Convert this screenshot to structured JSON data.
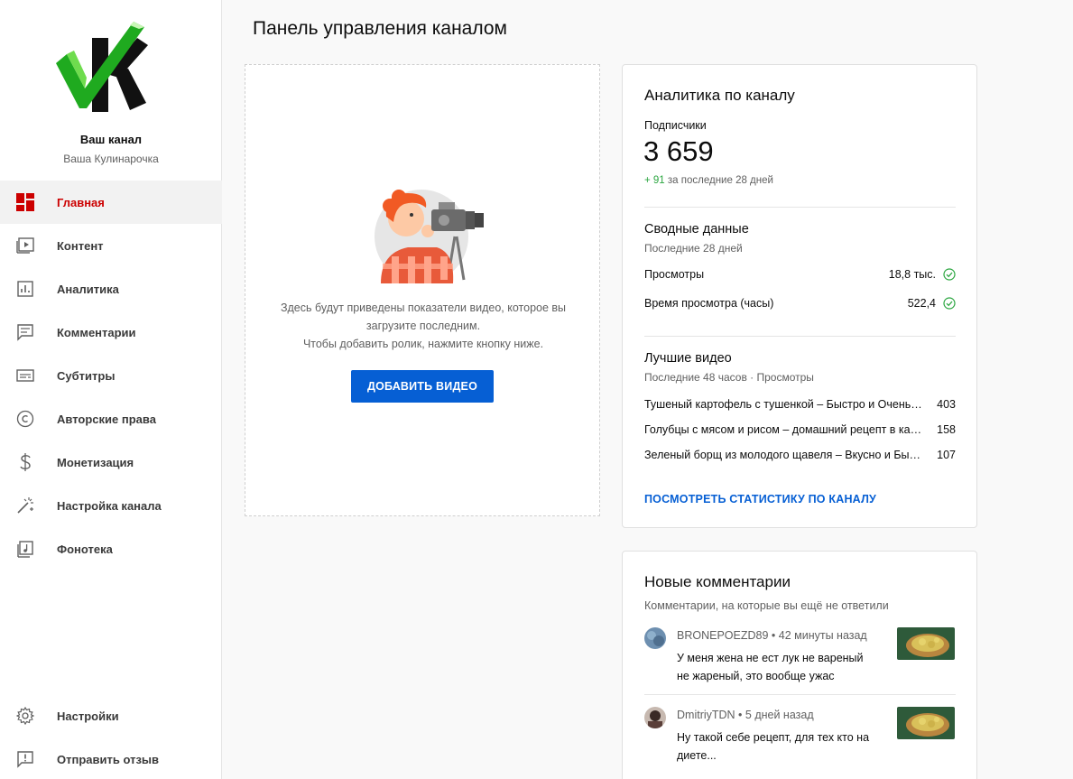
{
  "sidebar": {
    "channel_title": "Ваш канал",
    "channel_name": "Ваша Кулинарочка",
    "items": [
      {
        "label": "Главная",
        "icon": "dashboard-icon",
        "active": true
      },
      {
        "label": "Контент",
        "icon": "content-icon"
      },
      {
        "label": "Аналитика",
        "icon": "analytics-icon"
      },
      {
        "label": "Комментарии",
        "icon": "comments-icon"
      },
      {
        "label": "Субтитры",
        "icon": "subtitles-icon"
      },
      {
        "label": "Авторские права",
        "icon": "copyright-icon"
      },
      {
        "label": "Монетизация",
        "icon": "dollar-icon"
      },
      {
        "label": "Настройка канала",
        "icon": "magic-wand-icon"
      },
      {
        "label": "Фонотека",
        "icon": "audio-library-icon"
      }
    ],
    "bottom_items": [
      {
        "label": "Настройки",
        "icon": "gear-icon"
      },
      {
        "label": "Отправить отзыв",
        "icon": "feedback-icon"
      }
    ]
  },
  "page": {
    "title": "Панель управления каналом"
  },
  "upload": {
    "line1": "Здесь будут приведены показатели видео, которое вы",
    "line2": "загрузите последним.",
    "line3": "Чтобы добавить ролик, нажмите кнопку ниже.",
    "button": "ДОБАВИТЬ ВИДЕО"
  },
  "analytics": {
    "title": "Аналитика по каналу",
    "subscribers_label": "Подписчики",
    "subscribers_value": "3 659",
    "delta_value": "+ 91",
    "delta_text": "за последние 28 дней",
    "summary_title": "Сводные данные",
    "summary_period": "Последние 28 дней",
    "metrics": [
      {
        "label": "Просмотры",
        "value": "18,8 тыс."
      },
      {
        "label": "Время просмотра (часы)",
        "value": "522,4"
      }
    ],
    "top_title": "Лучшие видео",
    "top_period": "Последние 48 часов · Просмотры",
    "top_videos": [
      {
        "title": "Тушеный картофель с тушенкой – Быстро и Очень Вкусно",
        "views": "403"
      },
      {
        "title": "Голубцы с мясом и рисом – домашний рецепт в кастрюле",
        "views": "158"
      },
      {
        "title": "Зеленый борщ из молодого щавеля – Вкусно и Быстро",
        "views": "107"
      }
    ],
    "link": "ПОСМОТРЕТЬ СТАТИСТИКУ ПО КАНАЛУ",
    "accent": "#065fd4",
    "positive": "#2ba640"
  },
  "comments": {
    "title": "Новые комментарии",
    "subtitle": "Комментарии, на которые вы ещё не ответили",
    "items": [
      {
        "author": "BRONEPOEZD89",
        "time": "42 минуты назад",
        "line1": "У меня жена не ест лук не вареный",
        "line2": "не жареный, это вообще ужас"
      },
      {
        "author": "DmitriyTDN",
        "time": "5 дней назад",
        "line1": "Ну такой себе рецепт, для тех кто на",
        "line2": "диете..."
      }
    ]
  }
}
